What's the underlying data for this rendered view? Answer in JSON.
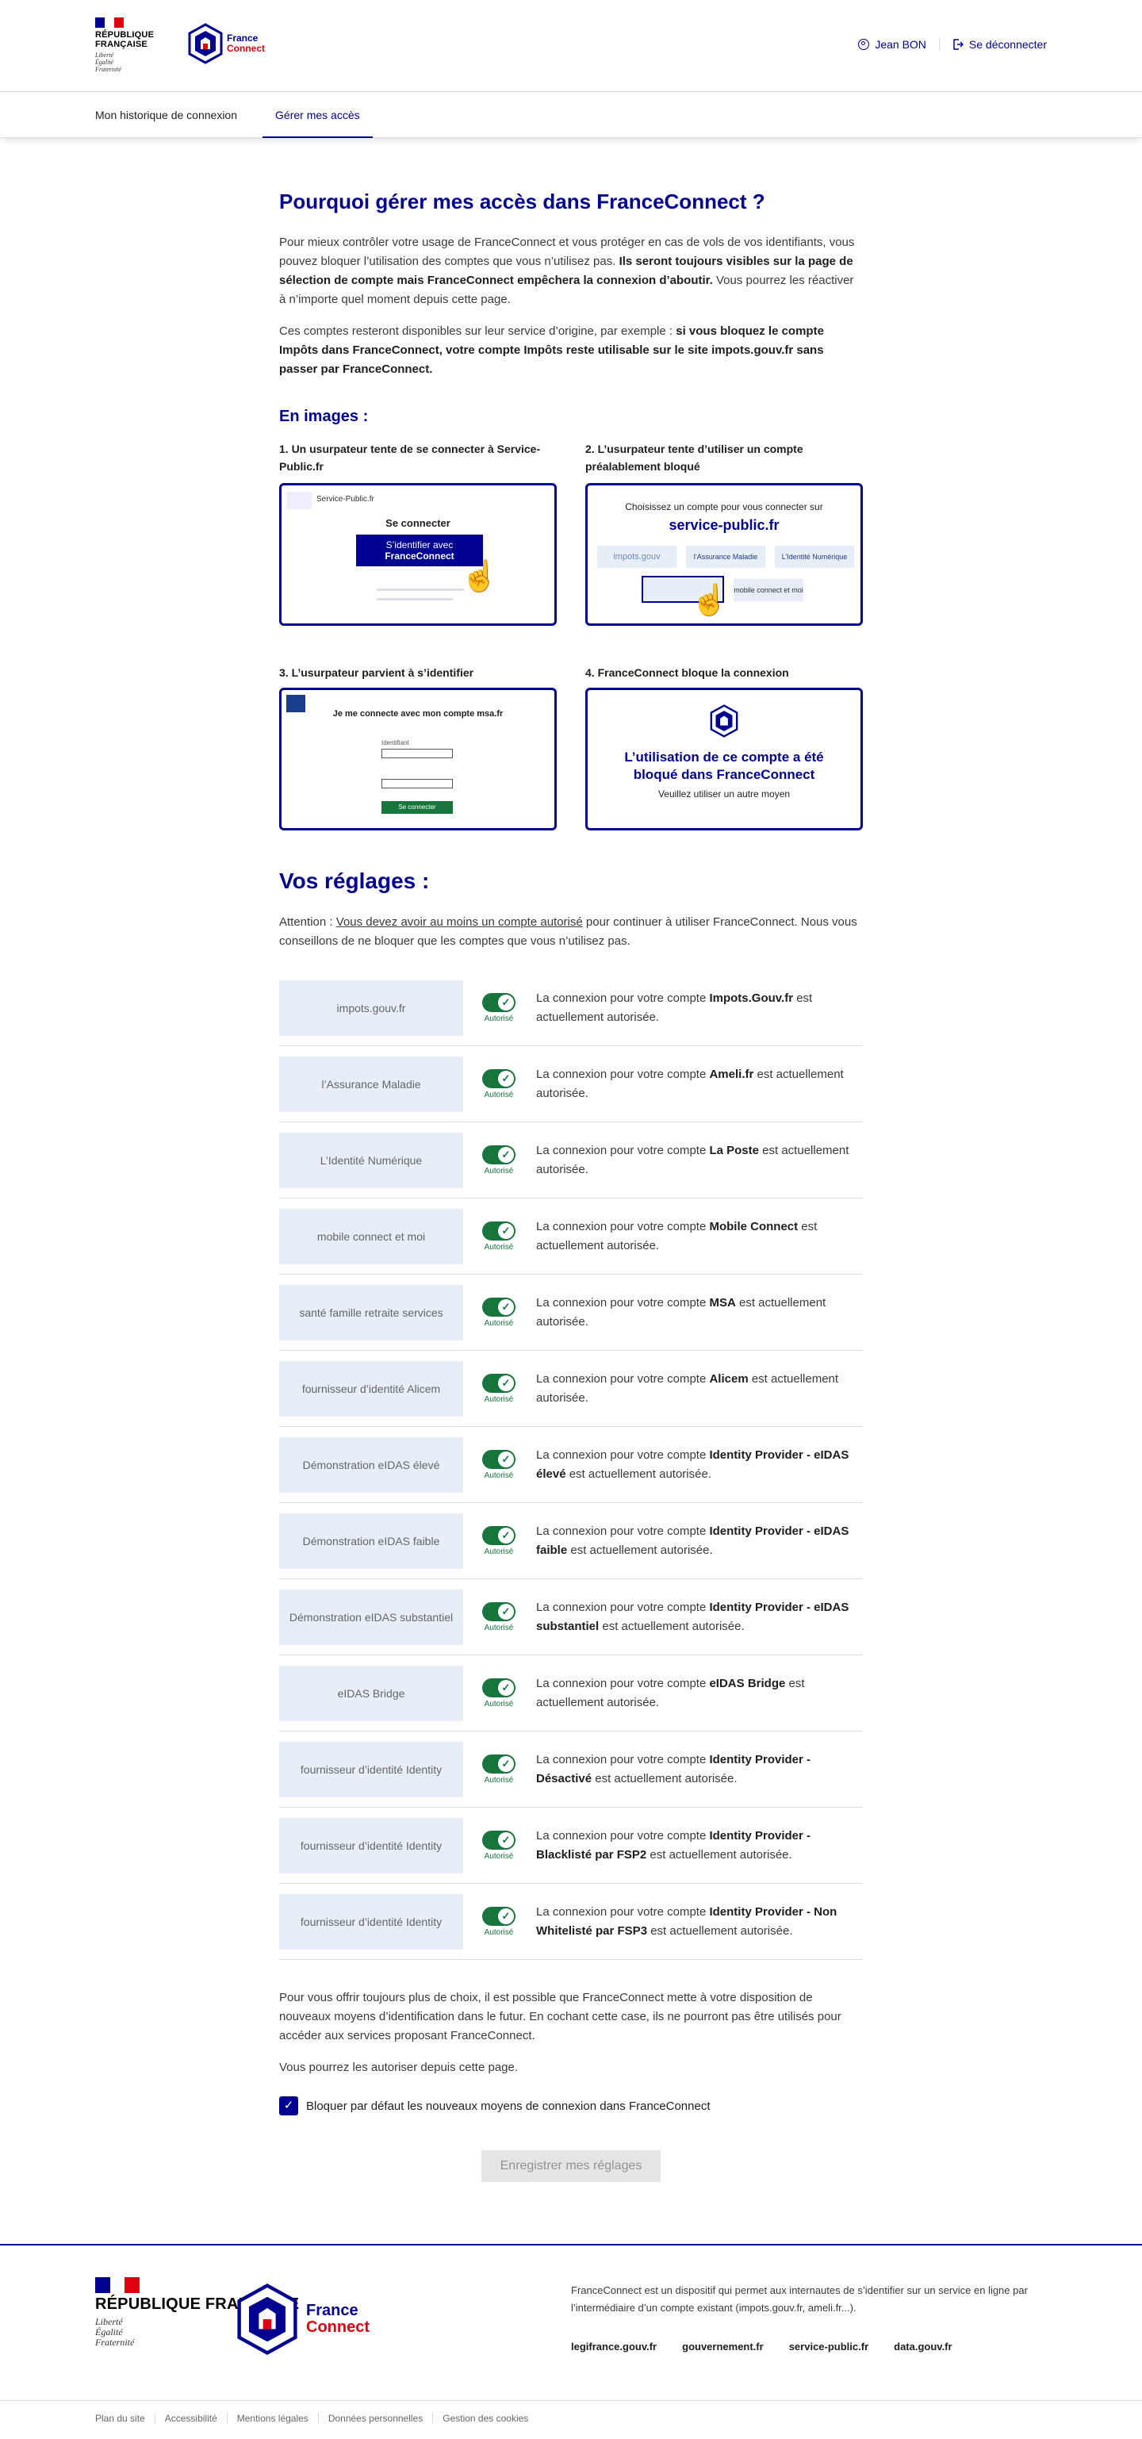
{
  "header": {
    "republique": "RÉPUBLIQUE FRANÇAISE",
    "motto": [
      "Liberté",
      "Égalité",
      "Fraternité"
    ],
    "fc_logo": [
      "France",
      "Connect"
    ],
    "user_name": "Jean BON",
    "logout": "Se déconnecter"
  },
  "nav": {
    "history": "Mon historique de connexion",
    "manage": "Gérer mes accès"
  },
  "intro": {
    "title": "Pourquoi gérer mes accès dans FranceConnect ?",
    "p1_a": "Pour mieux contrôler votre usage de FranceConnect et vous protéger en cas de vols de vos identifiants, vous pouvez bloquer l’utilisation des comptes que vous n’utilisez pas. ",
    "p1_b": "Ils seront toujours visibles sur la page de sélection de compte mais FranceConnect empêchera la connexion d’aboutir.",
    "p1_c": " Vous pourrez les réactiver à n’importe quel moment depuis cette page.",
    "p2_a": "Ces comptes resteront disponibles sur leur service d’origine, par exemple : ",
    "p2_b": "si vous bloquez le compte Impôts dans FranceConnect, votre compte Impôts reste utilisable sur le site impots.gouv.fr sans passer par FranceConnect."
  },
  "images": {
    "title": "En images :",
    "cap1": "1. Un usurpateur tente de se connecter à Service-Public.fr",
    "cap2": "2. L’usurpateur tente d’utiliser un compte préalablement bloqué",
    "cap3": "3. L’usurpateur parvient à s’identifier",
    "cap4": "4. FranceConnect bloque la connexion",
    "img1": {
      "site": "Service-Public.fr",
      "heading": "Se connecter",
      "btn1": "S’identifier avec",
      "btn2": "FranceConnect"
    },
    "img2": {
      "line1": "Choisissez un compte pour vous connecter sur",
      "line2": "service-public.fr",
      "p1": "impots.gouv",
      "p2": "l’Assurance Maladie",
      "p3": "L’Identité Numérique",
      "p4": "mobile connect et moi"
    },
    "img3": {
      "heading": "Je me connecte avec mon compte msa.fr",
      "sub": "Identifiant",
      "btn": "Se connecter"
    },
    "img4": {
      "line1": "L’utilisation de ce compte a été",
      "line2": "bloqué dans FranceConnect",
      "line3": "Veuillez utiliser un autre moyen"
    }
  },
  "settings": {
    "title": "Vos réglages :",
    "attn_a": "Attention : ",
    "attn_link": "Vous devez avoir au moins un compte autorisé",
    "attn_b": " pour continuer à utiliser FranceConnect. Nous vous conseillons de ne bloquer que les comptes que vous n’utilisez pas.",
    "toggle_label": "Autorisé",
    "prefix": "La connexion pour votre compte ",
    "suffix": " est actuellement autorisée.",
    "providers": [
      {
        "name": "Impots.Gouv.fr",
        "logo": "impots.gouv.fr"
      },
      {
        "name": "Ameli.fr",
        "logo": "l’Assurance Maladie"
      },
      {
        "name": "La Poste",
        "logo": "L’Identité Numérique"
      },
      {
        "name": "Mobile Connect",
        "logo": "mobile connect et moi"
      },
      {
        "name": "MSA",
        "logo": "santé famille retraite services"
      },
      {
        "name": "Alicem",
        "logo": "fournisseur d’identité Alicem"
      },
      {
        "name": "Identity Provider - eIDAS élevé",
        "logo": "Démonstration eIDAS élevé"
      },
      {
        "name": "Identity Provider - eIDAS faible",
        "logo": "Démonstration eIDAS faible"
      },
      {
        "name": "Identity Provider - eIDAS substantiel",
        "logo": "Démonstration eIDAS substantiel"
      },
      {
        "name": "eIDAS Bridge",
        "logo": "eIDAS Bridge"
      },
      {
        "name": "Identity Provider - Désactivé",
        "logo": "fournisseur d’identité Identity"
      },
      {
        "name": "Identity Provider - Blacklisté par FSP2",
        "logo": "fournisseur d’identité Identity"
      },
      {
        "name": "Identity Provider - Non Whitelisté par FSP3",
        "logo": "fournisseur d’identité Identity"
      }
    ]
  },
  "post": {
    "p1": "Pour vous offrir toujours plus de choix, il est possible que FranceConnect mette à votre disposition de nouveaux moyens d’identification dans le futur. En cochant cette case, ils ne pourront pas être utilisés pour accéder aux services proposant FranceConnect.",
    "p2": "Vous pourrez les autoriser depuis cette page.",
    "checkbox": "Bloquer par défaut les nouveaux moyens de connexion dans FranceConnect",
    "save": "Enregistrer mes réglages"
  },
  "footer": {
    "desc": "FranceConnect est un dispositif qui permet aux internautes de s’identifier sur un service en ligne par l’intermédiaire d’un compte existant (impots.gouv.fr, ameli.fr...).",
    "links": [
      "legifrance.gouv.fr",
      "gouvernement.fr",
      "service-public.fr",
      "data.gouv.fr"
    ],
    "bottom": [
      "Plan du site",
      "Accessibilité",
      "Mentions légales",
      "Données personnelles",
      "Gestion des cookies"
    ]
  },
  "colors": {
    "primary": "#000091",
    "success": "#18753c",
    "marianne_red": "#e1000f"
  }
}
